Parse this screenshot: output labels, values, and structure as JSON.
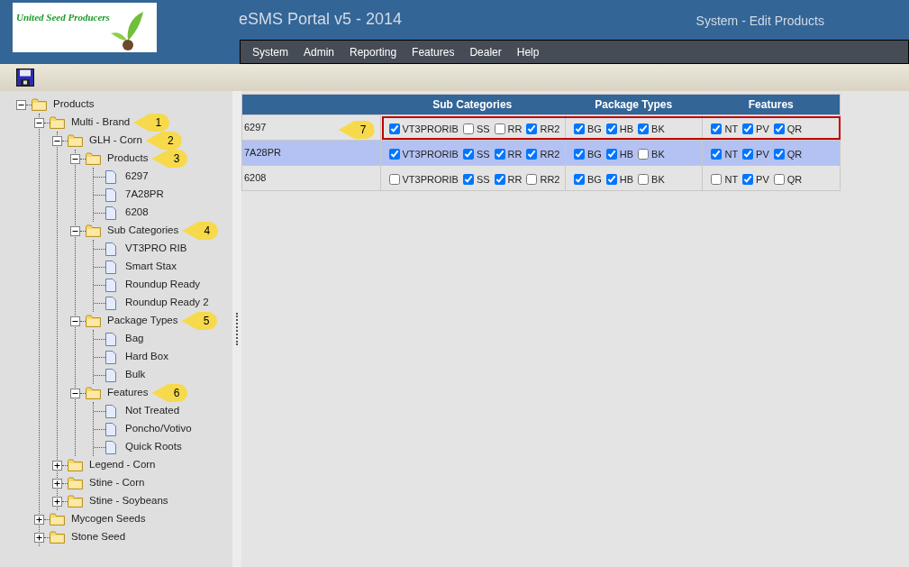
{
  "header": {
    "logo_text": "United Seed Producers",
    "title": "eSMS Portal v5 - 2014",
    "page_title": "System - Edit Products"
  },
  "menu": [
    "System",
    "Admin",
    "Reporting",
    "Features",
    "Dealer",
    "Help"
  ],
  "tree": [
    {
      "label": "Products",
      "kind": "folder",
      "expanded": true,
      "children": [
        {
          "label": "Multi - Brand",
          "kind": "folder",
          "expanded": true,
          "callout": "1",
          "children": [
            {
              "label": "GLH - Corn",
              "kind": "folder",
              "expanded": true,
              "callout": "2",
              "children": [
                {
                  "label": "Products",
                  "kind": "folder",
                  "expanded": true,
                  "callout": "3",
                  "children": [
                    {
                      "label": "6297",
                      "kind": "file"
                    },
                    {
                      "label": "7A28PR",
                      "kind": "file"
                    },
                    {
                      "label": "6208",
                      "kind": "file"
                    }
                  ]
                },
                {
                  "label": "Sub Categories",
                  "kind": "folder",
                  "expanded": true,
                  "callout": "4",
                  "children": [
                    {
                      "label": "VT3PRO RIB",
                      "kind": "file"
                    },
                    {
                      "label": "Smart Stax",
                      "kind": "file"
                    },
                    {
                      "label": "Roundup Ready",
                      "kind": "file"
                    },
                    {
                      "label": "Roundup Ready 2",
                      "kind": "file"
                    }
                  ]
                },
                {
                  "label": "Package Types",
                  "kind": "folder",
                  "expanded": true,
                  "callout": "5",
                  "children": [
                    {
                      "label": "Bag",
                      "kind": "file"
                    },
                    {
                      "label": "Hard Box",
                      "kind": "file"
                    },
                    {
                      "label": "Bulk",
                      "kind": "file"
                    }
                  ]
                },
                {
                  "label": "Features",
                  "kind": "folder",
                  "expanded": true,
                  "callout": "6",
                  "children": [
                    {
                      "label": "Not Treated",
                      "kind": "file"
                    },
                    {
                      "label": "Poncho/Votivo",
                      "kind": "file"
                    },
                    {
                      "label": "Quick Roots",
                      "kind": "file"
                    }
                  ]
                }
              ]
            },
            {
              "label": "Legend - Corn",
              "kind": "folder",
              "expanded": false
            },
            {
              "label": "Stine - Corn",
              "kind": "folder",
              "expanded": false
            },
            {
              "label": "Stine - Soybeans",
              "kind": "folder",
              "expanded": false
            }
          ]
        },
        {
          "label": "Mycogen Seeds",
          "kind": "folder",
          "expanded": false
        },
        {
          "label": "Stone Seed",
          "kind": "folder",
          "expanded": false
        }
      ]
    }
  ],
  "table": {
    "columns": [
      "Sub Categories",
      "Package Types",
      "Features"
    ],
    "rows": [
      {
        "product": "6297",
        "selected": false,
        "highlighted": true,
        "callout": "7",
        "groups": [
          [
            {
              "label": "VT3PRORIB",
              "checked": true
            },
            {
              "label": "SS",
              "checked": false
            },
            {
              "label": "RR",
              "checked": false
            },
            {
              "label": "RR2",
              "checked": true
            }
          ],
          [
            {
              "label": "BG",
              "checked": true
            },
            {
              "label": "HB",
              "checked": true
            },
            {
              "label": "BK",
              "checked": true
            }
          ],
          [
            {
              "label": "NT",
              "checked": true
            },
            {
              "label": "PV",
              "checked": true
            },
            {
              "label": "QR",
              "checked": true
            }
          ]
        ]
      },
      {
        "product": "7A28PR",
        "selected": true,
        "groups": [
          [
            {
              "label": "VT3PRORIB",
              "checked": true
            },
            {
              "label": "SS",
              "checked": true
            },
            {
              "label": "RR",
              "checked": true
            },
            {
              "label": "RR2",
              "checked": true
            }
          ],
          [
            {
              "label": "BG",
              "checked": true
            },
            {
              "label": "HB",
              "checked": true
            },
            {
              "label": "BK",
              "checked": false
            }
          ],
          [
            {
              "label": "NT",
              "checked": true
            },
            {
              "label": "PV",
              "checked": true
            },
            {
              "label": "QR",
              "checked": true
            }
          ]
        ]
      },
      {
        "product": "6208",
        "selected": false,
        "groups": [
          [
            {
              "label": "VT3PRORIB",
              "checked": false
            },
            {
              "label": "SS",
              "checked": true
            },
            {
              "label": "RR",
              "checked": true
            },
            {
              "label": "RR2",
              "checked": false
            }
          ],
          [
            {
              "label": "BG",
              "checked": true
            },
            {
              "label": "HB",
              "checked": true
            },
            {
              "label": "BK",
              "checked": false
            }
          ],
          [
            {
              "label": "NT",
              "checked": false
            },
            {
              "label": "PV",
              "checked": true
            },
            {
              "label": "QR",
              "checked": false
            }
          ]
        ]
      }
    ]
  }
}
